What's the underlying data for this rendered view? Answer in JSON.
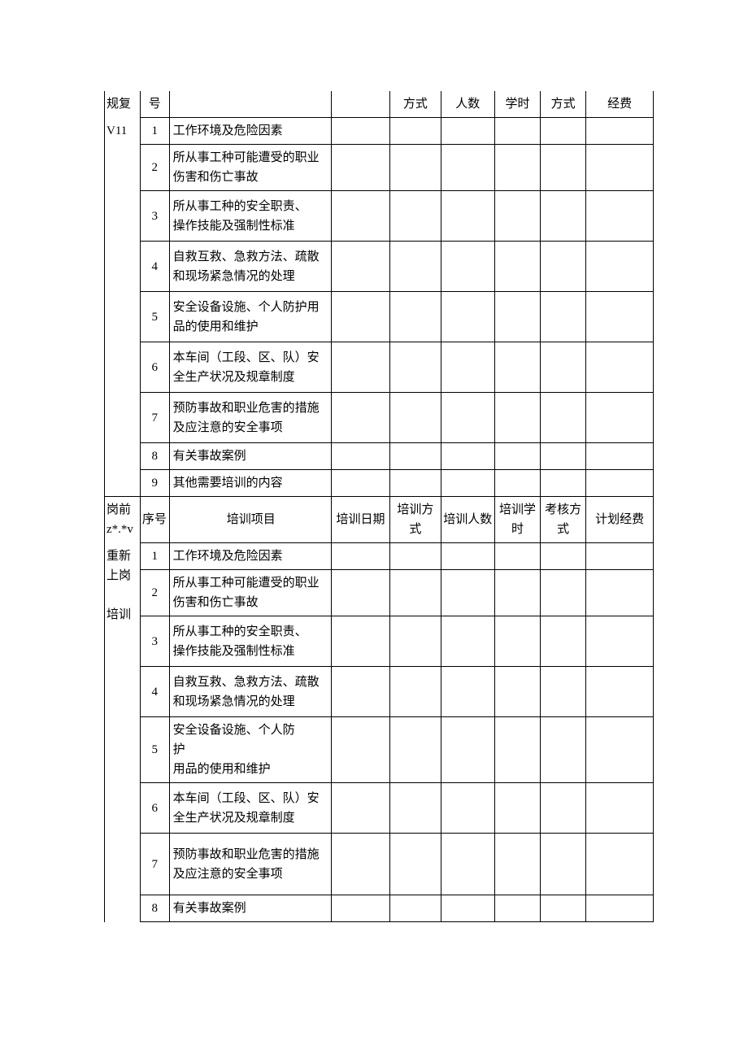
{
  "section1": {
    "category_part1": "规复",
    "category_part2": "V11",
    "header": {
      "seq": "号",
      "mode": "方式",
      "people": "人数",
      "hours": "学时",
      "assess": "方式",
      "fee": "经费"
    },
    "rows": [
      {
        "seq": "1",
        "item": "工作环境及危险因素"
      },
      {
        "seq": "2",
        "item": "所从事工种可能遭受的职业伤害和伤亡事故"
      },
      {
        "seq": "3",
        "item": "所从事工种的安全职责、\n操作技能及强制性标准"
      },
      {
        "seq": "4",
        "item": "自救互救、急救方法、疏散和现场紧急情况的处理"
      },
      {
        "seq": "5",
        "item": "安全设备设施、个人防护用品的使用和维护"
      },
      {
        "seq": "6",
        "item": "本车间（工段、区、队）安全生产状况及规章制度"
      },
      {
        "seq": "7",
        "item": "预防事故和职业危害的措施及应注意的安全事项"
      },
      {
        "seq": "8",
        "item": "有关事故案例"
      },
      {
        "seq": "9",
        "item": "其他需要培训的内容"
      }
    ]
  },
  "section2": {
    "category_line1": "岗前",
    "category_line2": "z*.*v",
    "category_line3": "重新",
    "category_line4": "上岗",
    "category_line5": "培训",
    "header": {
      "seq": "序号",
      "item": "培训项目",
      "date": "培训日期",
      "mode": "培训方式",
      "people": "培训人数",
      "hours": "培训学时",
      "assess": "考核方式",
      "fee": "计划经费"
    },
    "rows": [
      {
        "seq": "1",
        "item": "工作环境及危险因素"
      },
      {
        "seq": "2",
        "item": "所从事工种可能遭受的职业伤害和伤亡事故"
      },
      {
        "seq": "3",
        "item": "所从事工种的安全职责、\n操作技能及强制性标准"
      },
      {
        "seq": "4",
        "item": "自救互救、急救方法、疏散和现场紧急情况的处理"
      },
      {
        "seq": "5",
        "item": "安全设备设施、个人防\n护\n用品的使用和维护"
      },
      {
        "seq": "6",
        "item": "本车间（工段、区、队）安全生产状况及规章制度"
      },
      {
        "seq": "7",
        "item": "预防事故和职业危害的措施及应注意的安全事项"
      },
      {
        "seq": "8",
        "item": "有关事故案例"
      }
    ]
  }
}
